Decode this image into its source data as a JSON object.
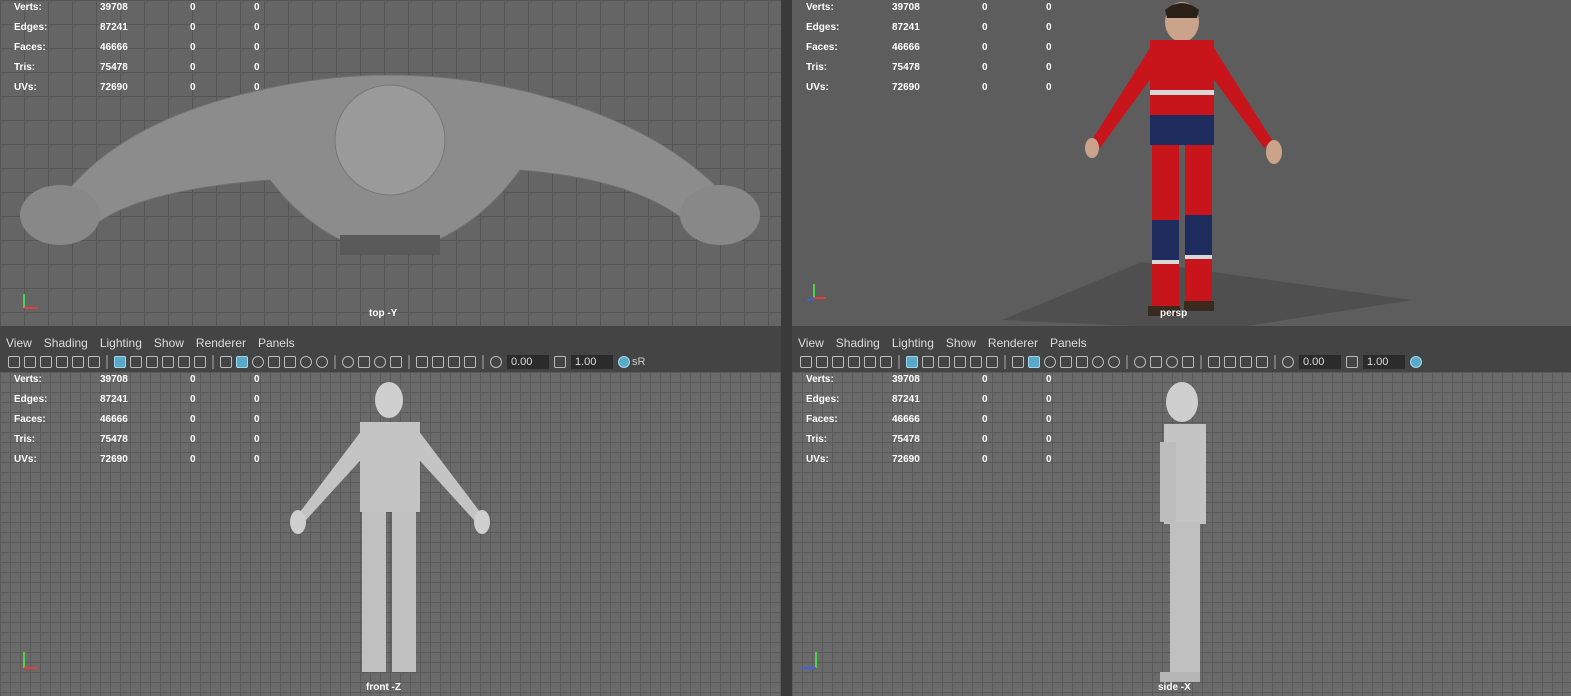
{
  "menu": [
    "View",
    "Shading",
    "Lighting",
    "Show",
    "Renderer",
    "Panels"
  ],
  "hud_stats": [
    {
      "label": "Verts:",
      "values": [
        "39708",
        "0",
        "0"
      ]
    },
    {
      "label": "Edges:",
      "values": [
        "87241",
        "0",
        "0"
      ]
    },
    {
      "label": "Faces:",
      "values": [
        "46666",
        "0",
        "0"
      ]
    },
    {
      "label": "Tris:",
      "values": [
        "75478",
        "0",
        "0"
      ]
    },
    {
      "label": "UVs:",
      "values": [
        "72690",
        "0",
        "0"
      ]
    }
  ],
  "toolbar": {
    "field1": "0.00",
    "field2": "1.00",
    "trailing": "sR"
  },
  "viewports": {
    "top": {
      "camera": "top -Y"
    },
    "persp": {
      "camera": "persp"
    },
    "front": {
      "camera": "front -Z"
    },
    "side": {
      "camera": "side -X"
    }
  },
  "colors": {
    "suit_red": "#c8141b",
    "suit_navy": "#1e2d5e",
    "reflective": "#d8d8d8",
    "accent": "#5aa9c9"
  }
}
